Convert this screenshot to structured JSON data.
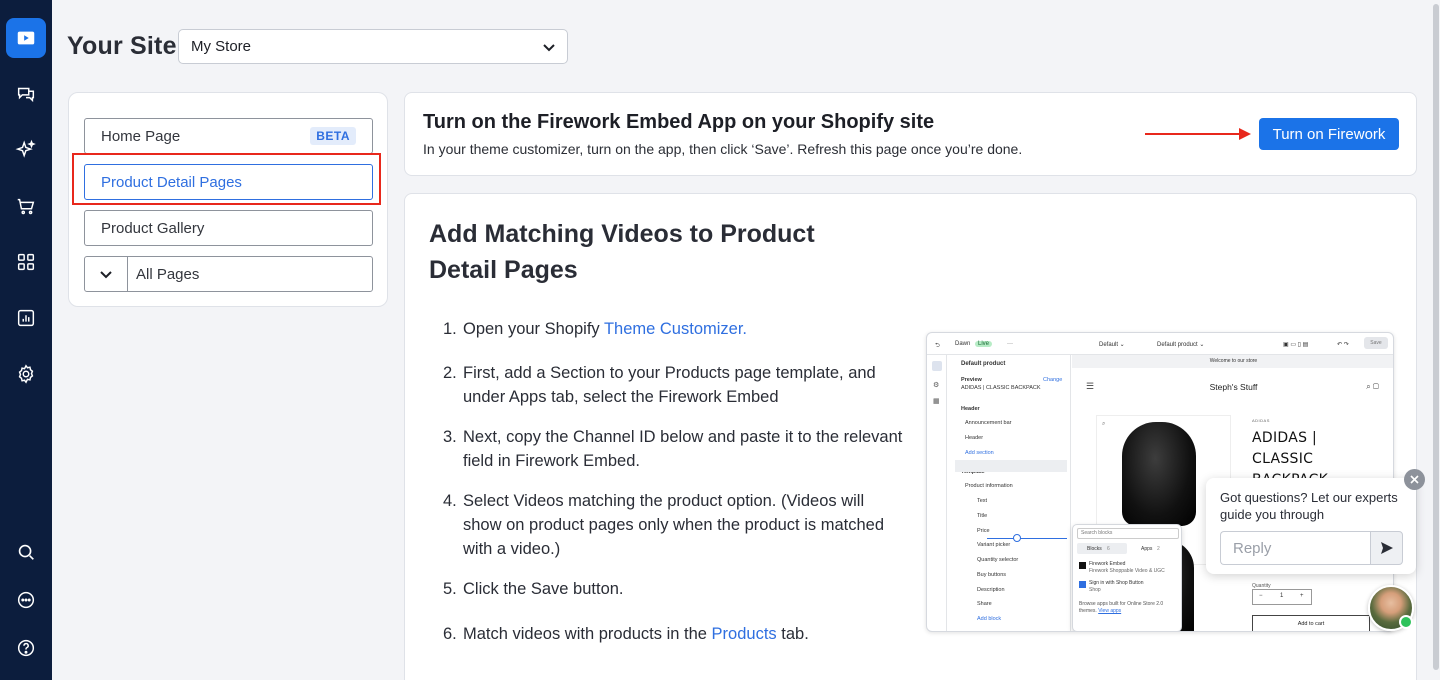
{
  "header": {
    "title": "Your Site",
    "store_select": "My Store"
  },
  "nav": {
    "items": [
      {
        "label": "Home Page",
        "badge": "BETA"
      },
      {
        "label": "Product Detail Pages"
      },
      {
        "label": "Product Gallery"
      },
      {
        "label": "All Pages"
      }
    ]
  },
  "banner": {
    "title": "Turn on the Firework Embed App on your Shopify site",
    "subtitle": "In your theme customizer, turn on the app, then click ‘Save’. Refresh this page once you’re done.",
    "button": "Turn on Firework"
  },
  "content": {
    "title": "Add Matching Videos to Product Detail Pages",
    "steps": [
      {
        "num": "1.",
        "text": "Open your Shopify ",
        "link": "Theme Customizer."
      },
      {
        "num": "2.",
        "text": "First, add a Section to your Products page template, and under Apps tab, select the Firework Embed"
      },
      {
        "num": "3.",
        "text": "Next, copy the Channel ID below and paste it to the relevant field in Firework Embed."
      },
      {
        "num": "4.",
        "text": "Select Videos matching the product option. (Videos will show on product pages only when the product is matched with a video.)"
      },
      {
        "num": "5.",
        "text": "Click the Save button."
      },
      {
        "num": "6.",
        "text": "Match videos with products in the ",
        "link": "Products",
        "suffix": " tab."
      }
    ]
  },
  "screenshot": {
    "theme": "Dawn",
    "live": "Live",
    "dots": "···",
    "default": "Default ⌄",
    "default_product": "Default product ⌄",
    "save": "Save",
    "panel_title": "Default product",
    "preview_label": "Preview",
    "change": "Change",
    "preview_value": "ADIDAS | CLASSIC BACKPACK",
    "header_label": "Header",
    "announcement": "Announcement bar",
    "header_item": "Header",
    "add_section": "Add section",
    "template_label": "Template",
    "product_information": "Product information",
    "text": "Text",
    "title": "Title",
    "price": "Price",
    "variant": "Variant picker",
    "quantity_selector": "Quantity selector",
    "buy_buttons": "Buy buttons",
    "description": "Description",
    "share": "Share",
    "add_block": "Add block",
    "welcome": "Welcome to our store",
    "store_name": "Steph's Stuff",
    "brand": "ADIDAS",
    "product_title_1": "ADIDAS |",
    "product_title_2": "CLASSIC",
    "product_title_3": "BACKPACK",
    "search_blocks": "Search blocks",
    "blocks_tab": "Blocks",
    "blocks_count": "6",
    "apps_tab": "Apps",
    "apps_count": "2",
    "firework_embed": "Firework Embed",
    "firework_desc": "Firework Shoppable Video & UGC",
    "shop_button": "Sign in with Shop Button",
    "shop": "Shop",
    "browse": "Browse apps built for Online Store 2.0",
    "browse2": "themes.",
    "view_apps": "View apps",
    "quantity": "Quantity",
    "qty_minus": "−",
    "qty_value": "1",
    "qty_plus": "+",
    "add_to_cart": "Add to cart"
  },
  "chat": {
    "message": "Got questions? Let our experts guide you through",
    "placeholder": "Reply"
  },
  "colors": {
    "rail": "#0c1d3d",
    "accent": "#1b73e8",
    "highlight": "#e8281c"
  }
}
